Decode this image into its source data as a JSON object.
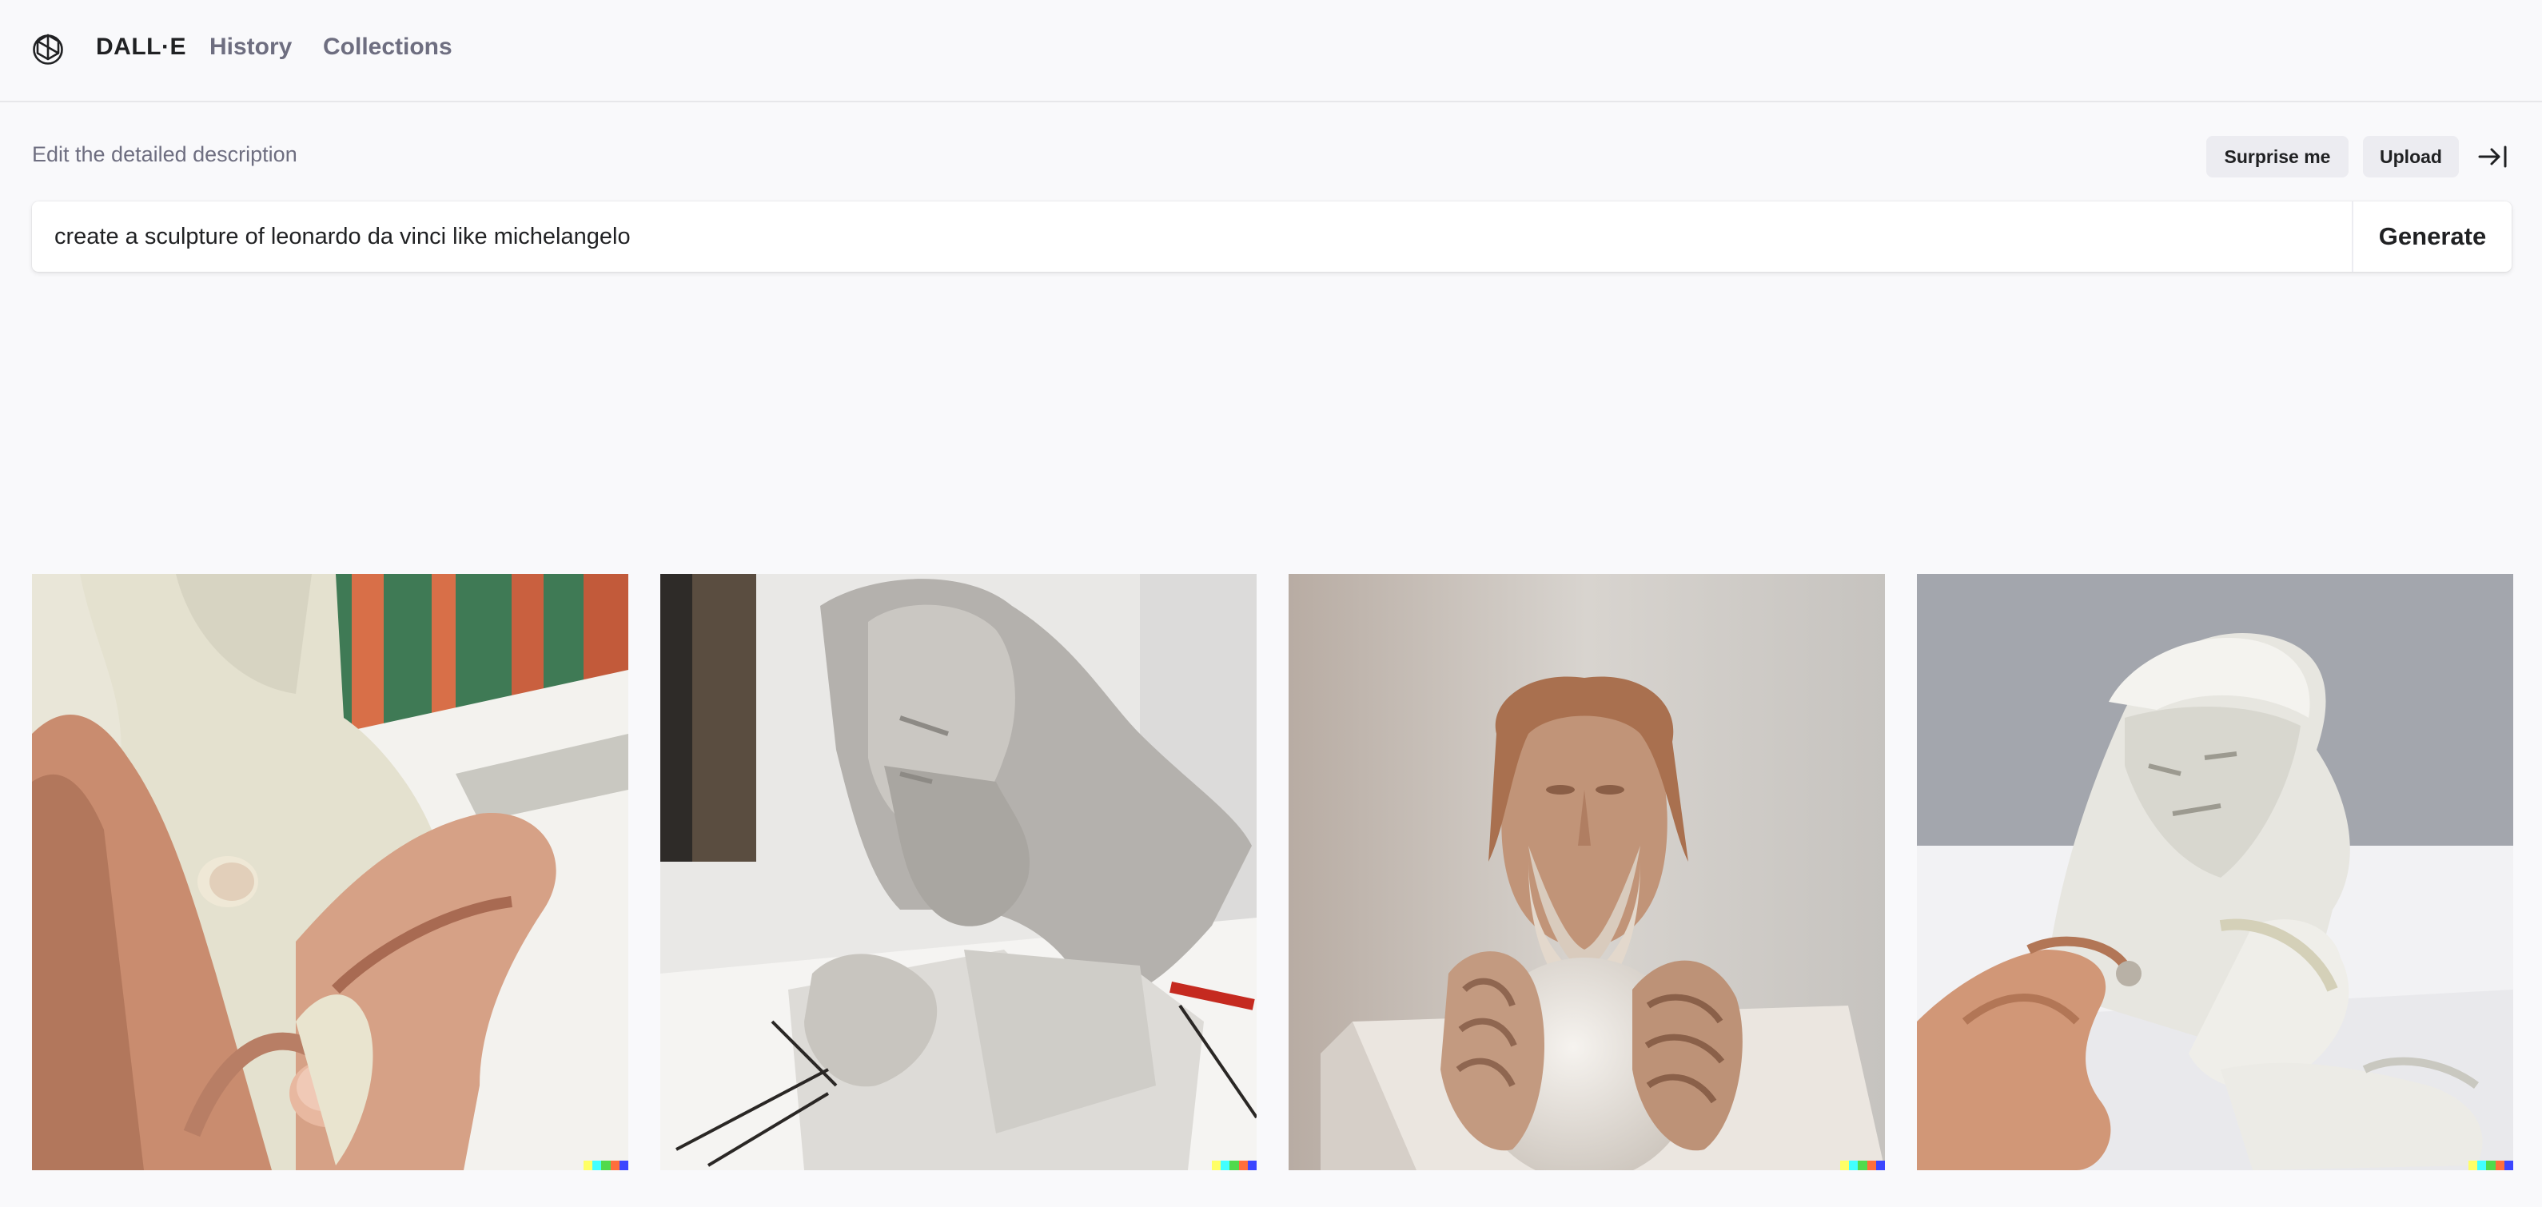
{
  "header": {
    "logo_icon": "openai-logo-icon",
    "brand": "DALL·E",
    "nav": [
      {
        "label": "History"
      },
      {
        "label": "Collections"
      }
    ]
  },
  "prompt": {
    "label": "Edit the detailed description",
    "surprise_label": "Surprise me",
    "upload_label": "Upload",
    "collapse_icon": "collapse-to-right-icon",
    "value": "create a sculpture of leonardo da vinci like michelangelo",
    "generate_label": "Generate"
  },
  "results": {
    "images": [
      {
        "alt": "Hands shaping a clay bust"
      },
      {
        "alt": "Grey clay bust of a bearded man"
      },
      {
        "alt": "Terracotta bust holding a sphere"
      },
      {
        "alt": "White marble bust with a hand"
      }
    ],
    "signature_colors": [
      "#ffff66",
      "#42ffff",
      "#51da4c",
      "#ff6e3c",
      "#3c46ff"
    ]
  }
}
